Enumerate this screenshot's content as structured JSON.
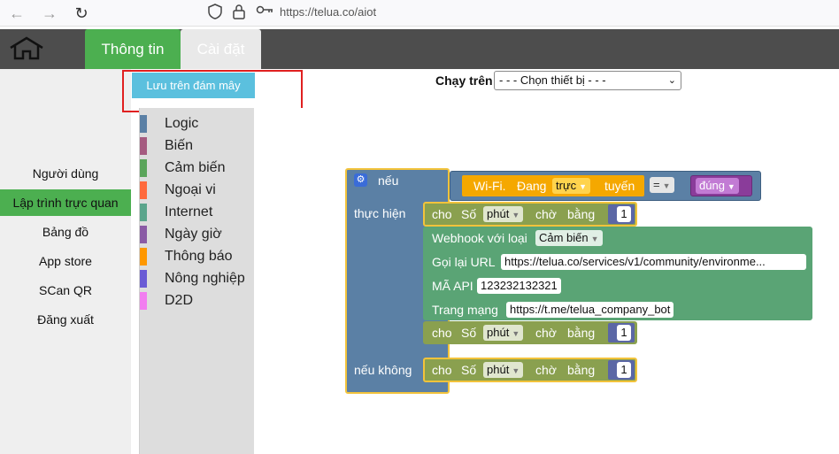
{
  "browser": {
    "url": "https://telua.co/aiot"
  },
  "header": {
    "tabs": [
      {
        "label": "Thông tin"
      },
      {
        "label": "Cài đặt"
      }
    ]
  },
  "sidebar": {
    "items": [
      {
        "label": "Người dùng"
      },
      {
        "label": "Lập trình trực quan"
      },
      {
        "label": "Bảng đồ"
      },
      {
        "label": "App store"
      },
      {
        "label": "SCan QR"
      },
      {
        "label": "Đăng xuất"
      }
    ],
    "active_index": 1
  },
  "toolbar": {
    "save_label": "Lưu trên đám mây",
    "run_label": "Chạy trên",
    "device_select_value": "- - - Chọn thiết bị - - -"
  },
  "toolbox": {
    "categories": [
      {
        "label": "Logic",
        "color": "#5b80a5"
      },
      {
        "label": "Biến",
        "color": "#a55b80"
      },
      {
        "label": "Cảm biến",
        "color": "#5ba55b"
      },
      {
        "label": "Ngoại vi",
        "color": "#ff6a3d"
      },
      {
        "label": "Internet",
        "color": "#5ba58c"
      },
      {
        "label": "Ngày giờ",
        "color": "#8a5ba5"
      },
      {
        "label": "Thông báo",
        "color": "#ff9800"
      },
      {
        "label": "Nông nghiệp",
        "color": "#6a5bd5"
      },
      {
        "label": "D2D",
        "color": "#f27ef0"
      }
    ]
  },
  "blocks": {
    "if_label": "nếu",
    "then_label": "thực hiện",
    "else_label": "nếu không",
    "condition": {
      "wifi_text": "Wi-Fi.",
      "status_text": "Đang",
      "state_value": "trực",
      "suffix_text": "tuyến",
      "operator": "=",
      "bool_value": "đúng"
    },
    "wait": {
      "prefix": "cho",
      "unit_label": "Số",
      "unit_value": "phút",
      "wait_label": "chờ",
      "equals_label": "bằng",
      "number": "1"
    },
    "webhook": {
      "title": "Webhook với loại",
      "type_value": "Cảm biến",
      "callback_label": "Gọi lại URL",
      "callback_value": "https://telua.co/services/v1/community/environme...",
      "api_label": "MÃ API",
      "api_value": "123232132321",
      "site_label": "Trang mạng",
      "site_value": "https://t.me/telua_company_bot"
    }
  }
}
